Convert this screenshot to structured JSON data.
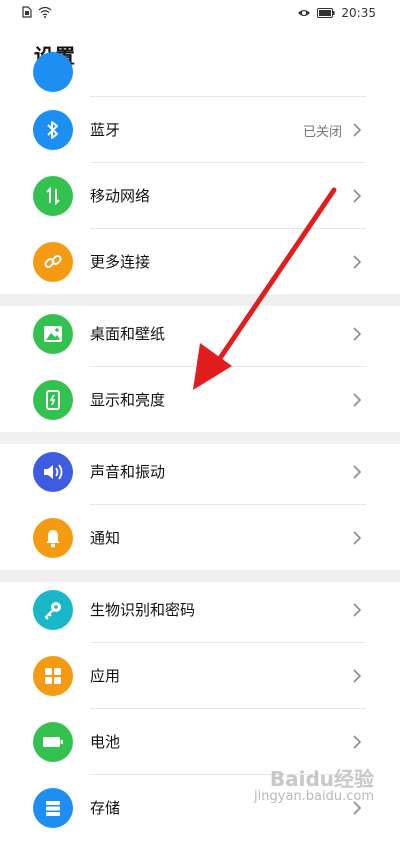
{
  "status": {
    "time": "20:35"
  },
  "page": {
    "title": "设置"
  },
  "rows": [
    {
      "label": "蓝牙",
      "value": "已关闭",
      "icon": "bluetooth-icon",
      "color": "#1d8ff2"
    },
    {
      "label": "移动网络",
      "value": "",
      "icon": "mobile-data-icon",
      "color": "#33c24f"
    },
    {
      "label": "更多连接",
      "value": "",
      "icon": "link-icon",
      "color": "#f59a13"
    },
    {
      "label": "桌面和壁纸",
      "value": "",
      "icon": "image-icon",
      "color": "#33c24f"
    },
    {
      "label": "显示和亮度",
      "value": "",
      "icon": "phone-brightness-icon",
      "color": "#33c24f"
    },
    {
      "label": "声音和振动",
      "value": "",
      "icon": "speaker-icon",
      "color": "#3f5ce0"
    },
    {
      "label": "通知",
      "value": "",
      "icon": "bell-icon",
      "color": "#f59a13"
    },
    {
      "label": "生物识别和密码",
      "value": "",
      "icon": "key-icon",
      "color": "#19b7c8"
    },
    {
      "label": "应用",
      "value": "",
      "icon": "apps-grid-icon",
      "color": "#f59a13"
    },
    {
      "label": "电池",
      "value": "",
      "icon": "battery-icon",
      "color": "#33c24f"
    },
    {
      "label": "存储",
      "value": "",
      "icon": "storage-icon",
      "color": "#1d8ff2"
    }
  ],
  "watermark": {
    "brand": "Baidu经验",
    "url": "jingyan.baidu.com"
  },
  "colors": {
    "arrow": "#e21d1d",
    "chevron": "#8a8a8a",
    "group_gap": "#f0f0f0"
  }
}
